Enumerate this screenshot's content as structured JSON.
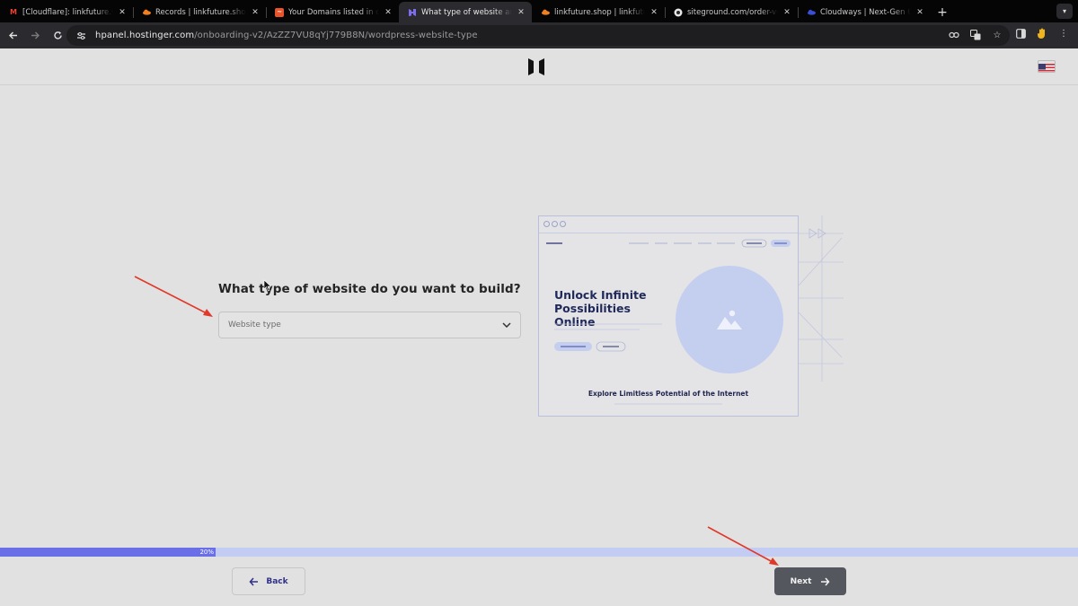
{
  "browser": {
    "tabs": [
      {
        "title": "[Cloudflare]: linkfuture.shop i",
        "favicon": "gmail-icon"
      },
      {
        "title": "Records | linkfuture.shop | M",
        "favicon": "cloudflare-icon"
      },
      {
        "title": "Your Domains listed in one pl",
        "favicon": "domains-icon"
      },
      {
        "title": "What type of website are you",
        "favicon": "hostinger-icon",
        "active": true
      },
      {
        "title": "linkfuture.shop | linkfuture.sh",
        "favicon": "cloudflare-icon"
      },
      {
        "title": "siteground.com/order-verific",
        "favicon": "siteground-icon"
      },
      {
        "title": "Cloudways | Next-Gen Cloud",
        "favicon": "cloudways-icon"
      }
    ],
    "url_host": "hpanel.hostinger.com",
    "url_path": "/onboarding-v2/AzZZ7VU8qYj779B8N/wordpress-website-type"
  },
  "page": {
    "question": "What type of website do you want to build?",
    "select_placeholder": "Website type",
    "illustration": {
      "headline": "Unlock Infinite Possibilities Online",
      "caption": "Explore Limitless Potential of the Internet"
    },
    "progress": {
      "percent": 20,
      "label": "20%"
    },
    "back_label": "Back",
    "next_label": "Next"
  },
  "colors": {
    "progress_fill": "#6b6fe7",
    "progress_track": "#c3cdf3",
    "next_button": "#55575f",
    "back_text": "#31308b",
    "annotation_arrow": "#e0392b"
  }
}
